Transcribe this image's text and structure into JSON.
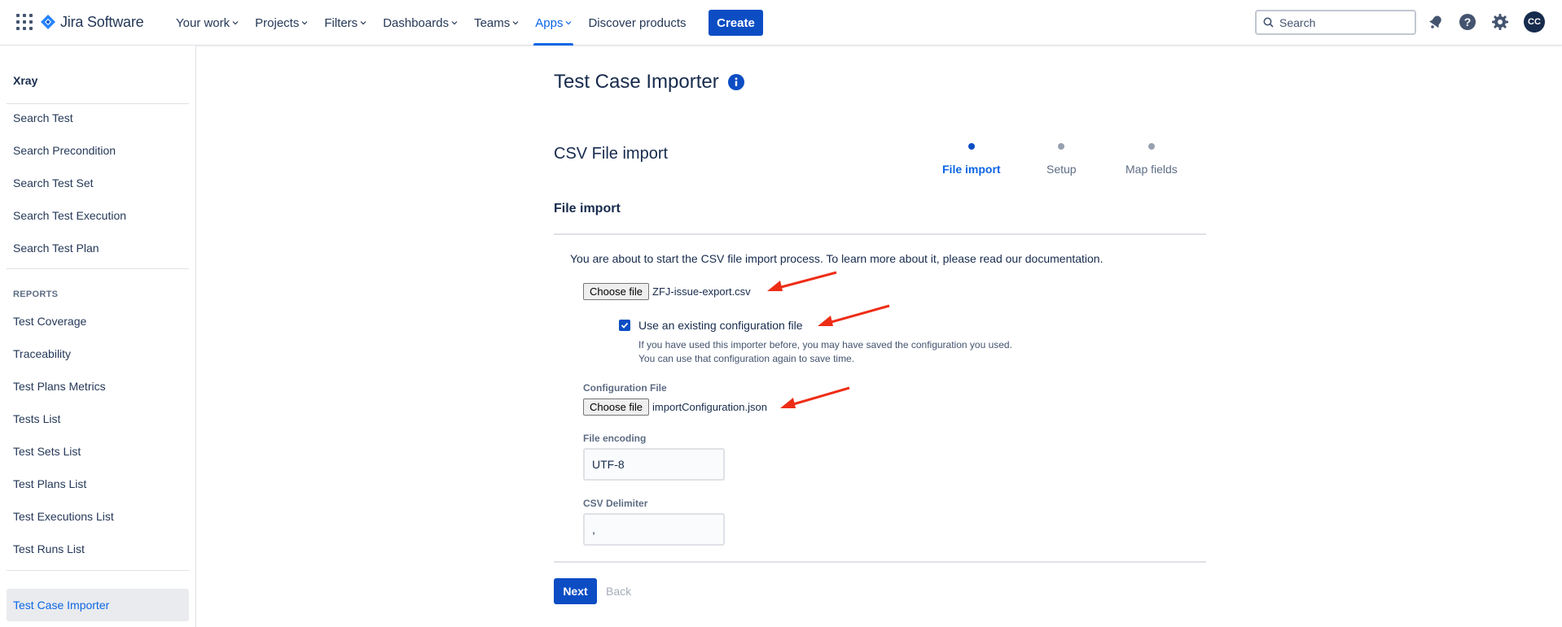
{
  "topbar": {
    "product_name": "Jira Software",
    "nav": [
      {
        "label": "Your work",
        "dropdown": true
      },
      {
        "label": "Projects",
        "dropdown": true
      },
      {
        "label": "Filters",
        "dropdown": true
      },
      {
        "label": "Dashboards",
        "dropdown": true
      },
      {
        "label": "Teams",
        "dropdown": true
      },
      {
        "label": "Apps",
        "dropdown": true,
        "active": true
      },
      {
        "label": "Discover products",
        "dropdown": false
      }
    ],
    "create_label": "Create",
    "search_placeholder": "Search",
    "icons": [
      "notifications-icon",
      "help-icon",
      "settings-icon"
    ],
    "avatar_initials": "CC"
  },
  "sidebar": {
    "title": "Xray",
    "search_items": [
      "Search Test",
      "Search Precondition",
      "Search Test Set",
      "Search Test Execution",
      "Search Test Plan"
    ],
    "reports_heading": "REPORTS",
    "report_items": [
      "Test Coverage",
      "Traceability",
      "Test Plans Metrics",
      "Tests List",
      "Test Sets List",
      "Test Plans List",
      "Test Executions List",
      "Test Runs List"
    ],
    "active_item": "Test Case Importer"
  },
  "main": {
    "page_title": "Test Case Importer",
    "section_title": "CSV File import",
    "steps": [
      {
        "label": "File import",
        "current": true
      },
      {
        "label": "Setup",
        "current": false
      },
      {
        "label": "Map fields",
        "current": false
      }
    ],
    "subsection_title": "File import",
    "intro_text": "You are about to start the CSV file import process. To learn more about it, please read our documentation.",
    "choose_file_label": "Choose file",
    "csv_file_name": "ZFJ-issue-export.csv",
    "use_config_label": "Use an existing configuration file",
    "use_config_checked": true,
    "use_config_help": "If you have used this importer before, you may have saved the configuration you used. You can use that configuration again to save time.",
    "config_file_label": "Configuration File",
    "config_file_name": "importConfiguration.json",
    "encoding_label": "File encoding",
    "encoding_value": "UTF-8",
    "delimiter_label": "CSV Delimiter",
    "delimiter_value": ",",
    "next_label": "Next",
    "back_label": "Back"
  },
  "colors": {
    "brand_blue": "#0c4dc4",
    "link_blue": "#0c66e4",
    "annotation_arrow": "#ee2d16"
  }
}
